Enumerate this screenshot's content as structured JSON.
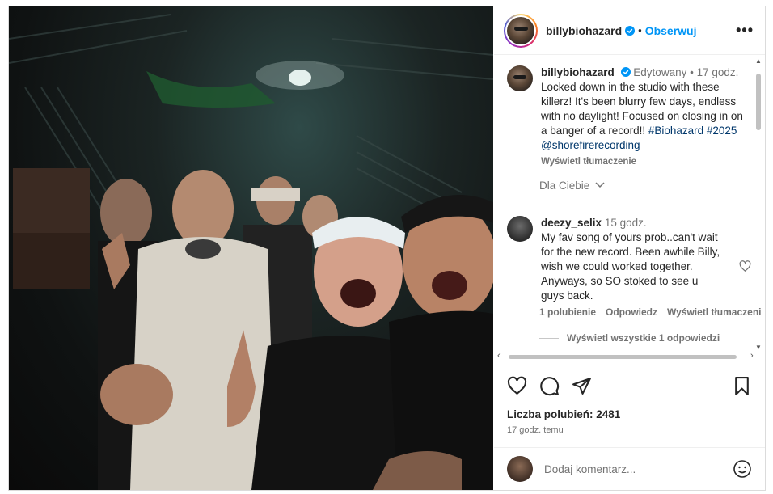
{
  "post": {
    "username": "billybiohazard",
    "follow_label": "Obserwuj",
    "separator": "•",
    "more_label": "•••"
  },
  "caption": {
    "username": "billybiohazard",
    "edited": "Edytowany",
    "separator": "•",
    "time": "17 godz.",
    "text": "Locked down in the studio with these killerz! It's been blurry few days, endless with no daylight! Focused on closing in on a banger of a record!! ",
    "hashtags": "#Biohazard #2025 @shorefirerecording",
    "translate_label": "Wyświetl tłumaczenie"
  },
  "filter": {
    "label": "Dla Ciebie"
  },
  "comment": {
    "username": "deezy_selix",
    "time": "15 godz.",
    "text": "My fav song of yours prob..can't wait for the new record. Been awhile Billy, wish we could worked together. Anyways, so SO stoked to see u guys back.",
    "likes_label": "1 polubienie",
    "reply_label": "Odpowiedz",
    "translate_label": "Wyświetl tłumaczeni",
    "view_replies": "Wyświetl wszystkie 1 odpowiedzi"
  },
  "stats": {
    "likes_label": "Liczba polubień: 2481",
    "time_label": "17 godz. temu"
  },
  "composer": {
    "placeholder": "Dodaj komentarz..."
  },
  "colors": {
    "accent": "#0095f6",
    "muted": "#737373",
    "link": "#00376b",
    "verified": "#0095f6"
  },
  "icons": [
    "verified-icon",
    "more-icon",
    "heart-icon",
    "comment-icon",
    "share-icon",
    "bookmark-icon",
    "emoji-icon",
    "chevron-down-icon"
  ]
}
